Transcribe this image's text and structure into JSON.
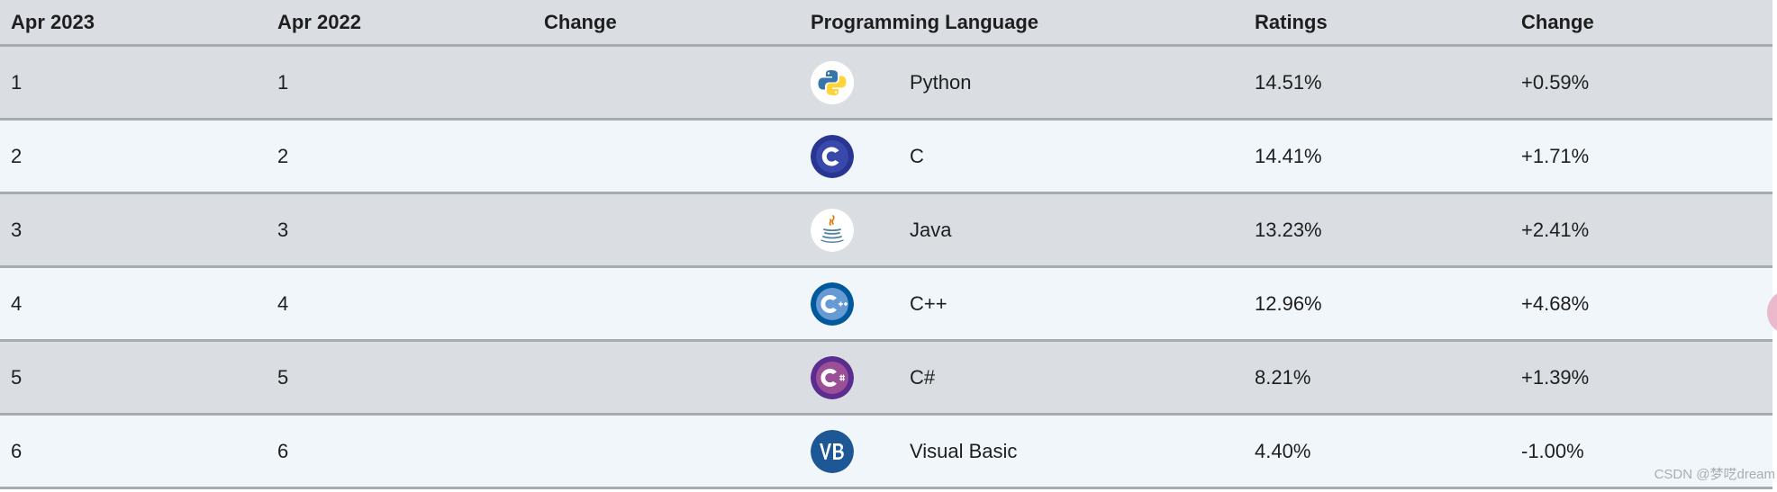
{
  "headers": [
    "Apr 2023",
    "Apr 2022",
    "Change",
    "Programming Language",
    "Ratings",
    "Change"
  ],
  "rows": [
    {
      "rank_now": "1",
      "rank_prev": "1",
      "change_icon": "",
      "logo": "python-icon",
      "language": "Python",
      "rating": "14.51%",
      "change": "+0.59%"
    },
    {
      "rank_now": "2",
      "rank_prev": "2",
      "change_icon": "",
      "logo": "c-icon",
      "language": "C",
      "rating": "14.41%",
      "change": "+1.71%"
    },
    {
      "rank_now": "3",
      "rank_prev": "3",
      "change_icon": "",
      "logo": "java-icon",
      "language": "Java",
      "rating": "13.23%",
      "change": "+2.41%"
    },
    {
      "rank_now": "4",
      "rank_prev": "4",
      "change_icon": "",
      "logo": "cpp-icon",
      "language": "C++",
      "rating": "12.96%",
      "change": "+4.68%"
    },
    {
      "rank_now": "5",
      "rank_prev": "5",
      "change_icon": "",
      "logo": "csharp-icon",
      "language": "C#",
      "rating": "8.21%",
      "change": "+1.39%"
    },
    {
      "rank_now": "6",
      "rank_prev": "6",
      "change_icon": "",
      "logo": "vb-icon",
      "language": "Visual Basic",
      "rating": "4.40%",
      "change": "-1.00%"
    }
  ],
  "watermark": "CSDN @梦呓dream",
  "colors": {
    "header_bg": "#dadee2",
    "odd_row_bg": "#dadee2",
    "even_row_bg": "#f1f6fa",
    "row_divider": "#a7acb0"
  }
}
